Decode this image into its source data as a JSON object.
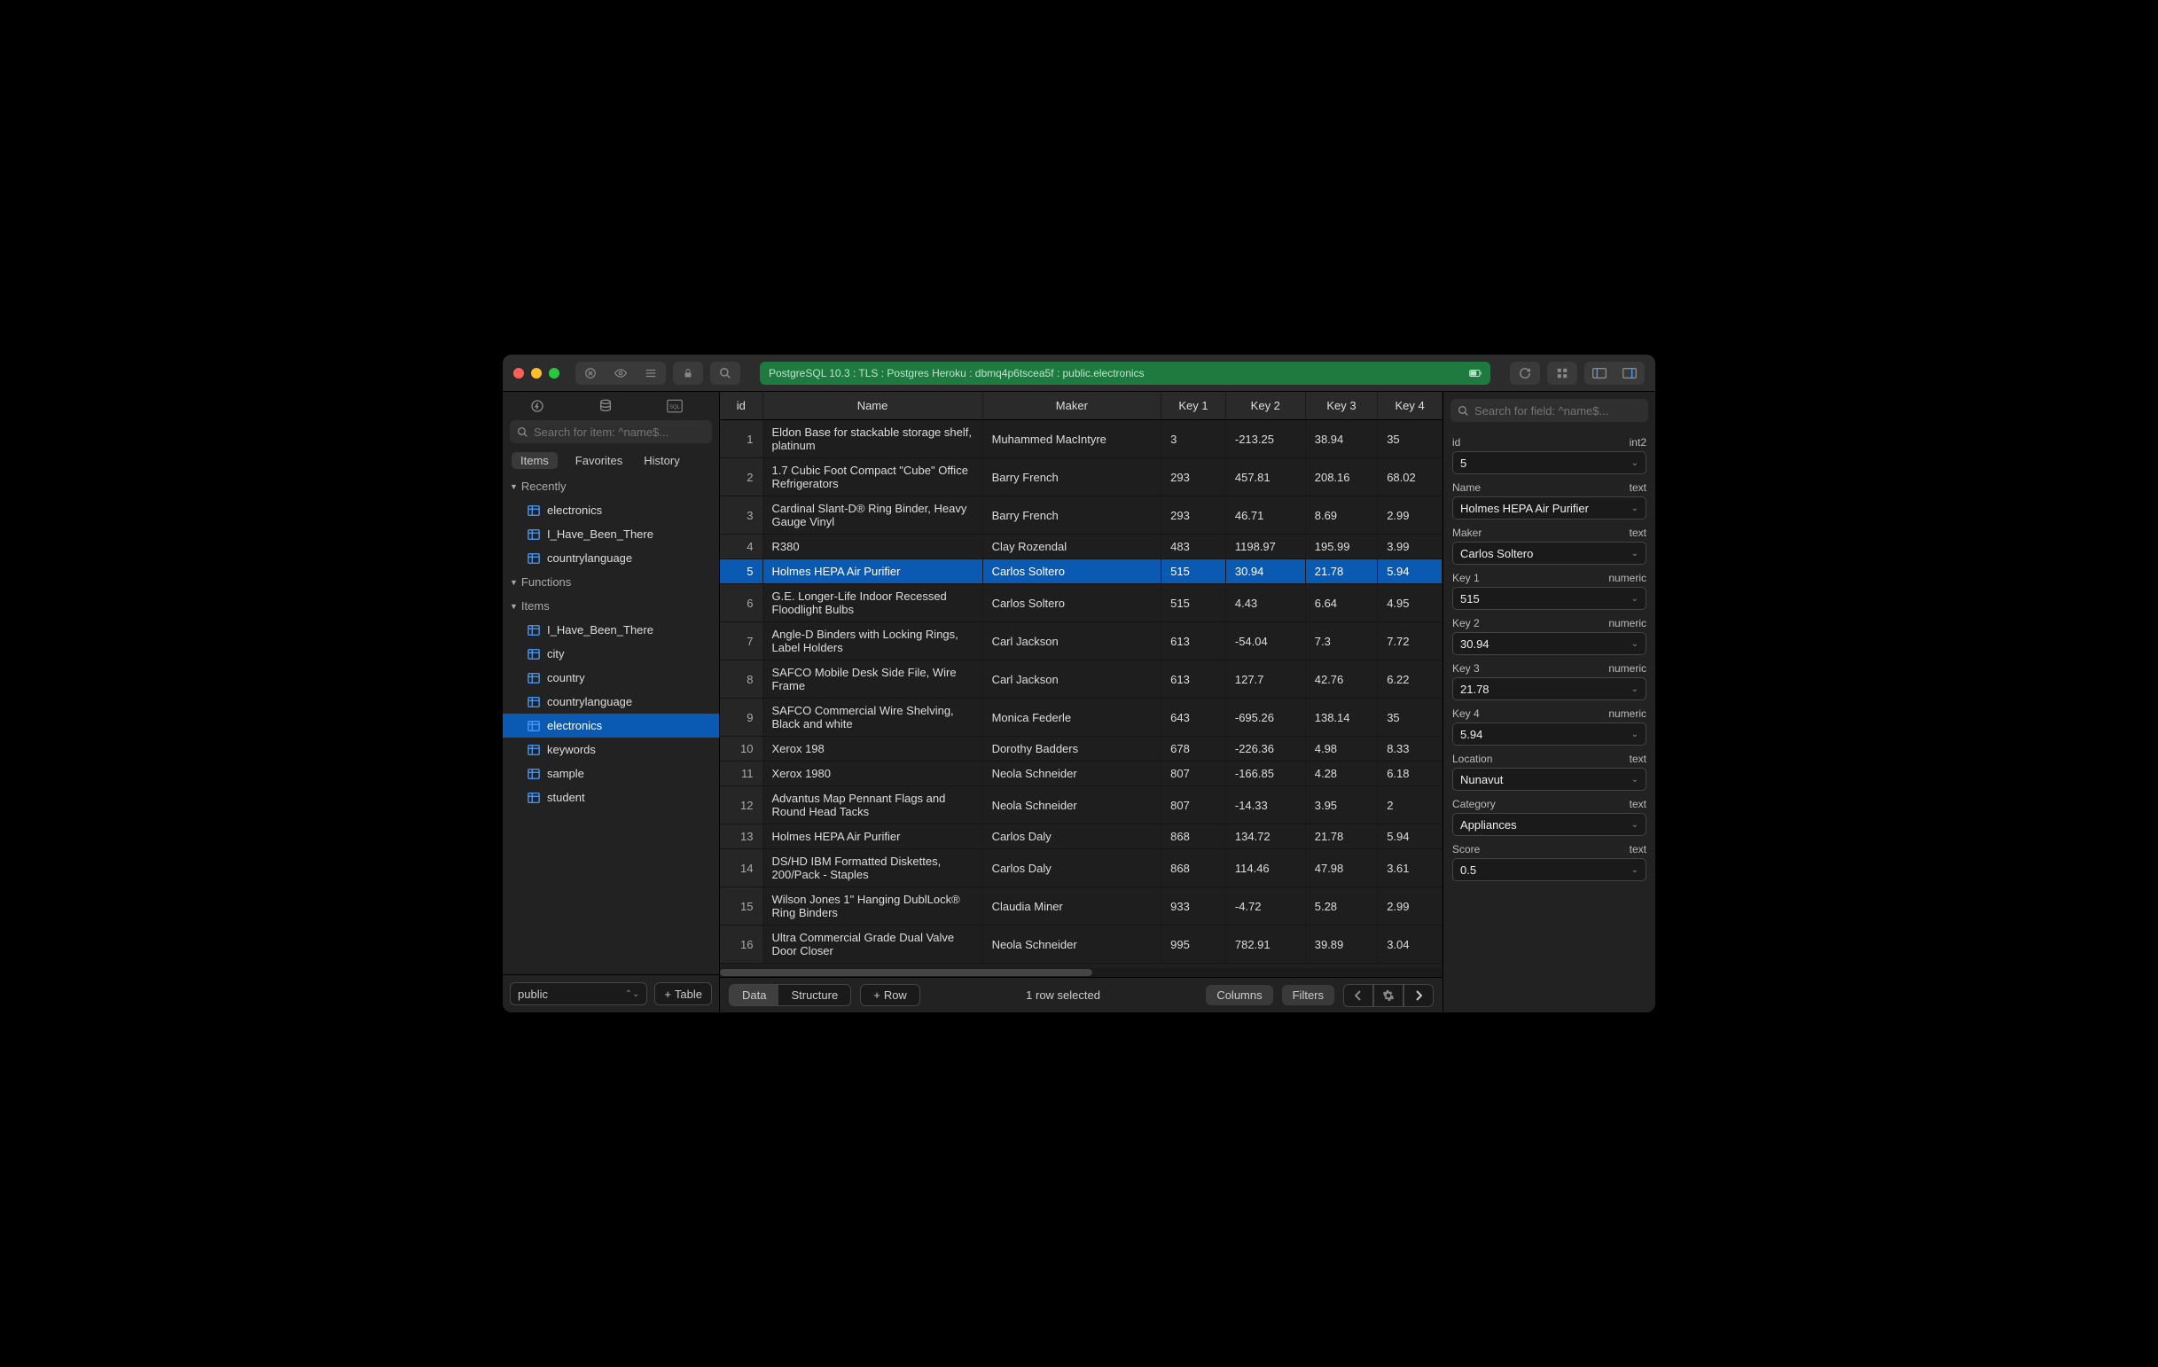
{
  "connection": "PostgreSQL 10.3 : TLS : Postgres Heroku : dbmq4p6tscea5f : public.electronics",
  "sidebar": {
    "search_placeholder": "Search for item: ^name$...",
    "tabs": [
      "Items",
      "Favorites",
      "History"
    ],
    "sections": [
      {
        "label": "Recently",
        "items": [
          "electronics",
          "I_Have_Been_There",
          "countrylanguage"
        ]
      },
      {
        "label": "Functions",
        "items": []
      },
      {
        "label": "Items",
        "items": [
          "I_Have_Been_There",
          "city",
          "country",
          "countrylanguage",
          "electronics",
          "keywords",
          "sample",
          "student"
        ]
      }
    ],
    "selected_item": "electronics",
    "schema": "public",
    "add_table_label": "Table"
  },
  "table": {
    "columns": [
      "id",
      "Name",
      "Maker",
      "Key 1",
      "Key 2",
      "Key 3",
      "Key 4"
    ],
    "rows": [
      {
        "id": 1,
        "name": "Eldon Base for stackable storage shelf, platinum",
        "maker": "Muhammed MacIntyre",
        "k1": "3",
        "k2": "-213.25",
        "k3": "38.94",
        "k4": "35"
      },
      {
        "id": 2,
        "name": "1.7 Cubic Foot Compact \"Cube\" Office Refrigerators",
        "maker": "Barry French",
        "k1": "293",
        "k2": "457.81",
        "k3": "208.16",
        "k4": "68.02"
      },
      {
        "id": 3,
        "name": "Cardinal Slant-D® Ring Binder, Heavy Gauge Vinyl",
        "maker": "Barry French",
        "k1": "293",
        "k2": "46.71",
        "k3": "8.69",
        "k4": "2.99"
      },
      {
        "id": 4,
        "name": "R380",
        "maker": "Clay Rozendal",
        "k1": "483",
        "k2": "1198.97",
        "k3": "195.99",
        "k4": "3.99"
      },
      {
        "id": 5,
        "name": "Holmes HEPA Air Purifier",
        "maker": "Carlos Soltero",
        "k1": "515",
        "k2": "30.94",
        "k3": "21.78",
        "k4": "5.94"
      },
      {
        "id": 6,
        "name": "G.E. Longer-Life Indoor Recessed Floodlight Bulbs",
        "maker": "Carlos Soltero",
        "k1": "515",
        "k2": "4.43",
        "k3": "6.64",
        "k4": "4.95"
      },
      {
        "id": 7,
        "name": "Angle-D Binders with Locking Rings, Label Holders",
        "maker": "Carl Jackson",
        "k1": "613",
        "k2": "-54.04",
        "k3": "7.3",
        "k4": "7.72"
      },
      {
        "id": 8,
        "name": "SAFCO Mobile Desk Side File, Wire Frame",
        "maker": "Carl Jackson",
        "k1": "613",
        "k2": "127.7",
        "k3": "42.76",
        "k4": "6.22"
      },
      {
        "id": 9,
        "name": "SAFCO Commercial Wire Shelving, Black and white",
        "maker": "Monica Federle",
        "k1": "643",
        "k2": "-695.26",
        "k3": "138.14",
        "k4": "35"
      },
      {
        "id": 10,
        "name": "Xerox 198",
        "maker": "Dorothy Badders",
        "k1": "678",
        "k2": "-226.36",
        "k3": "4.98",
        "k4": "8.33"
      },
      {
        "id": 11,
        "name": "Xerox 1980",
        "maker": "Neola Schneider",
        "k1": "807",
        "k2": "-166.85",
        "k3": "4.28",
        "k4": "6.18"
      },
      {
        "id": 12,
        "name": "Advantus Map Pennant Flags and Round Head Tacks",
        "maker": "Neola Schneider",
        "k1": "807",
        "k2": "-14.33",
        "k3": "3.95",
        "k4": "2"
      },
      {
        "id": 13,
        "name": "Holmes HEPA Air Purifier",
        "maker": "Carlos Daly",
        "k1": "868",
        "k2": "134.72",
        "k3": "21.78",
        "k4": "5.94"
      },
      {
        "id": 14,
        "name": "DS/HD IBM Formatted Diskettes, 200/Pack - Staples",
        "maker": "Carlos Daly",
        "k1": "868",
        "k2": "114.46",
        "k3": "47.98",
        "k4": "3.61"
      },
      {
        "id": 15,
        "name": "Wilson Jones 1\" Hanging DublLock® Ring Binders",
        "maker": "Claudia Miner",
        "k1": "933",
        "k2": "-4.72",
        "k3": "5.28",
        "k4": "2.99"
      },
      {
        "id": 16,
        "name": "Ultra Commercial Grade Dual Valve Door Closer",
        "maker": "Neola Schneider",
        "k1": "995",
        "k2": "782.91",
        "k3": "39.89",
        "k4": "3.04"
      }
    ],
    "selected_row_id": 5
  },
  "bottom": {
    "segments": [
      "Data",
      "Structure"
    ],
    "row_label": "Row",
    "status": "1 row selected",
    "columns_label": "Columns",
    "filters_label": "Filters"
  },
  "inspector": {
    "search_placeholder": "Search for field: ^name$...",
    "fields": [
      {
        "name": "id",
        "type": "int2",
        "value": "5"
      },
      {
        "name": "Name",
        "type": "text",
        "value": "Holmes HEPA Air Purifier"
      },
      {
        "name": "Maker",
        "type": "text",
        "value": "Carlos Soltero"
      },
      {
        "name": "Key 1",
        "type": "numeric",
        "value": "515"
      },
      {
        "name": "Key 2",
        "type": "numeric",
        "value": "30.94"
      },
      {
        "name": "Key 3",
        "type": "numeric",
        "value": "21.78"
      },
      {
        "name": "Key 4",
        "type": "numeric",
        "value": "5.94"
      },
      {
        "name": "Location",
        "type": "text",
        "value": "Nunavut"
      },
      {
        "name": "Category",
        "type": "text",
        "value": "Appliances"
      },
      {
        "name": "Score",
        "type": "text",
        "value": "0.5"
      }
    ]
  }
}
